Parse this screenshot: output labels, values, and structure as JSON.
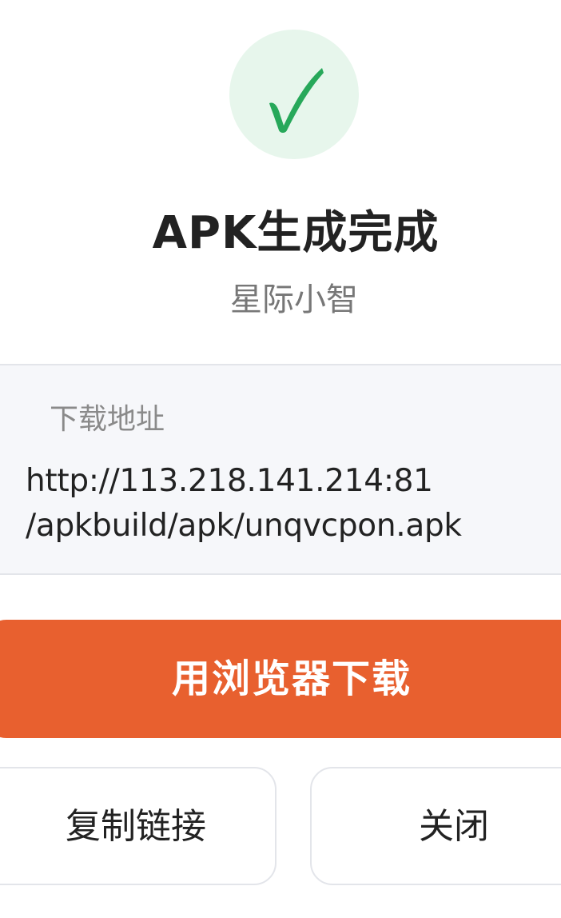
{
  "dialog": {
    "status_icon": "check-icon",
    "title": "APK生成完成",
    "subtitle": "星际小智",
    "download": {
      "label": "下载地址",
      "url_line1": "http://113.218.141.214:81",
      "url_line2": "/apkbuild/apk/unqvcpon.apk"
    },
    "actions": {
      "primary_label": "用浏览器下载",
      "copy_label": "复制链接",
      "close_label": "关闭"
    }
  },
  "colors": {
    "accent": "#e8602f",
    "success": "#27a85a",
    "success_bg": "#e7f6ec"
  }
}
